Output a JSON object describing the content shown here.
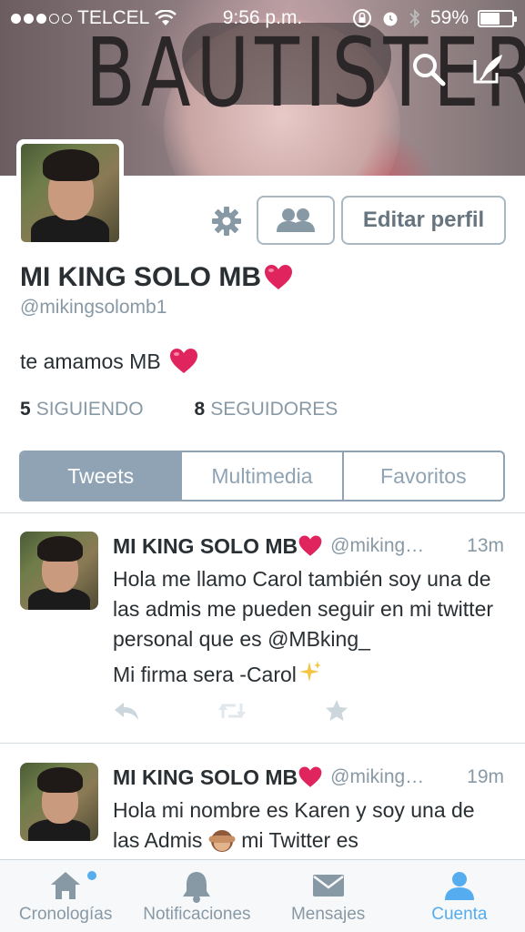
{
  "status_bar": {
    "carrier": "TELCEL",
    "time": "9:56 p.m.",
    "battery": "59%",
    "battery_level": 0.59,
    "signal_bars_filled": 3,
    "signal_bars_total": 5
  },
  "header": {
    "banner_text": "BAUTISTER"
  },
  "profile": {
    "name": "MI KING SOLO MB",
    "handle": "@mikingsolomb1",
    "bio": "te amamos MB",
    "edit_label": "Editar perfil",
    "following_count": "5",
    "following_label": "SIGUIENDO",
    "followers_count": "8",
    "followers_label": "SEGUIDORES"
  },
  "tabs": [
    {
      "label": "Tweets",
      "active": true
    },
    {
      "label": "Multimedia",
      "active": false
    },
    {
      "label": "Favoritos",
      "active": false
    }
  ],
  "tweets": [
    {
      "name": "MI KING SOLO MB",
      "handle": "@miking…",
      "time": "13m",
      "text_1": "Hola me llamo Carol también soy una de las admis me pueden seguir en mi twitter personal que es @MBking_",
      "text_2": "Mi firma sera -Carol"
    },
    {
      "name": "MI KING SOLO MB",
      "handle": "@miking…",
      "time": "19m",
      "text_1": "Hola mi nombre es Karen y soy una de las Admis",
      "text_1b": "mi Twitter es"
    }
  ],
  "tabbar": [
    {
      "label": "Cronologías",
      "icon": "home-icon",
      "active": false
    },
    {
      "label": "Notificaciones",
      "icon": "bell-icon",
      "active": false
    },
    {
      "label": "Mensajes",
      "icon": "envelope-icon",
      "active": false
    },
    {
      "label": "Cuenta",
      "icon": "person-icon",
      "active": true
    }
  ],
  "colors": {
    "accent": "#55acee",
    "tab_active_bg": "#8fa3b4",
    "muted_text": "#8899a6",
    "heart": "#e0245e"
  }
}
